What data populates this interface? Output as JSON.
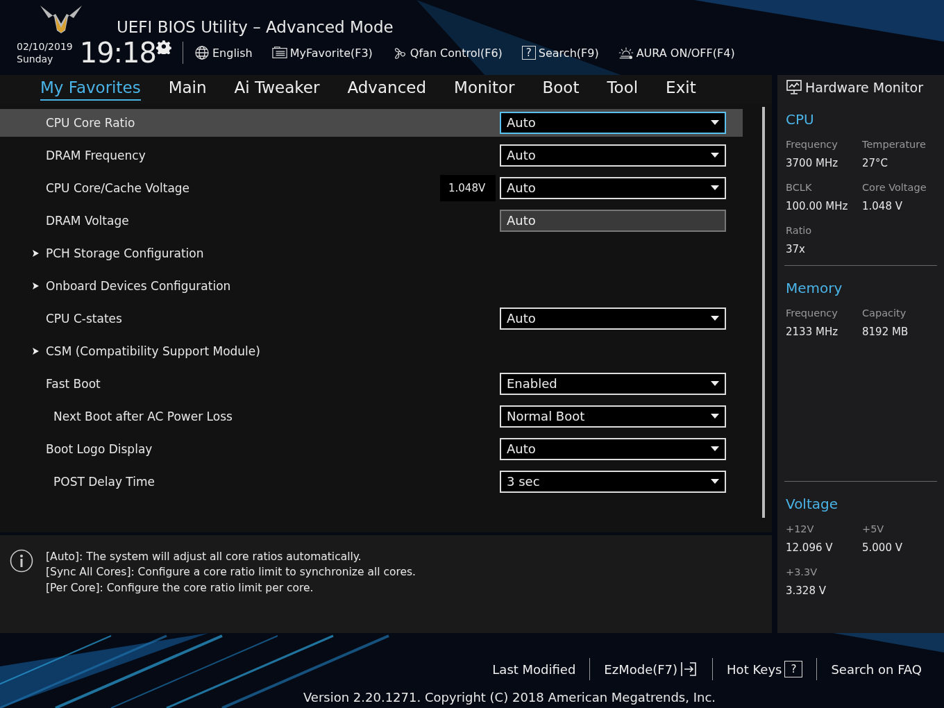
{
  "header": {
    "title": "UEFI BIOS Utility – Advanced Mode",
    "date": "02/10/2019",
    "day": "Sunday",
    "time": "19:18",
    "tools": [
      {
        "kind": "language",
        "label": "English"
      },
      {
        "kind": "favorite",
        "label": "MyFavorite(F3)"
      },
      {
        "kind": "fan",
        "label": "Qfan Control(F6)"
      },
      {
        "kind": "search",
        "label": "Search(F9)",
        "glyph": "?"
      },
      {
        "kind": "aura",
        "label": "AURA ON/OFF(F4)"
      }
    ]
  },
  "tabs": [
    {
      "label": "My Favorites",
      "selected": true
    },
    {
      "label": "Main",
      "selected": false
    },
    {
      "label": "Ai Tweaker",
      "selected": false
    },
    {
      "label": "Advanced",
      "selected": false
    },
    {
      "label": "Monitor",
      "selected": false
    },
    {
      "label": "Boot",
      "selected": false
    },
    {
      "label": "Tool",
      "selected": false
    },
    {
      "label": "Exit",
      "selected": false
    }
  ],
  "settings": [
    {
      "kind": "dropdown",
      "label": "CPU Core Ratio",
      "value": "Auto",
      "selected": true
    },
    {
      "kind": "dropdown",
      "label": "DRAM Frequency",
      "value": "Auto",
      "selected": false
    },
    {
      "kind": "dropdown",
      "label": "CPU Core/Cache Voltage",
      "reading": "1.048V",
      "value": "Auto",
      "selected": false
    },
    {
      "kind": "text",
      "label": "DRAM Voltage",
      "value": "Auto",
      "selected": false
    },
    {
      "kind": "submenu",
      "label": "PCH Storage Configuration",
      "selected": false
    },
    {
      "kind": "submenu",
      "label": "Onboard Devices Configuration",
      "selected": false
    },
    {
      "kind": "dropdown",
      "label": "CPU C-states",
      "value": "Auto",
      "selected": false
    },
    {
      "kind": "submenu",
      "label": "CSM (Compatibility Support Module)",
      "selected": false
    },
    {
      "kind": "dropdown",
      "label": "Fast Boot",
      "value": "Enabled",
      "selected": false,
      "children": [
        {
          "kind": "dropdown",
          "label": "Next Boot after AC Power Loss",
          "value": "Normal Boot",
          "selected": false
        }
      ]
    },
    {
      "kind": "dropdown",
      "label": "Boot Logo Display",
      "value": "Auto",
      "selected": false,
      "children": [
        {
          "kind": "dropdown",
          "label": "POST Delay Time",
          "value": "3 sec",
          "selected": false
        }
      ]
    }
  ],
  "help": [
    "[Auto]: The system will adjust all core ratios automatically.",
    "[Sync All Cores]: Configure a core ratio limit to synchronize all cores.",
    "[Per Core]: Configure the core ratio limit per core."
  ],
  "hardware_monitor": {
    "title": "Hardware Monitor",
    "sections": [
      {
        "title": "CPU",
        "items": [
          {
            "label": "Frequency",
            "value": "3700 MHz"
          },
          {
            "label": "Temperature",
            "value": "27°C"
          },
          {
            "label": "BCLK",
            "value": "100.00 MHz"
          },
          {
            "label": "Core Voltage",
            "value": "1.048 V"
          },
          {
            "label": "Ratio",
            "value": "37x"
          }
        ]
      },
      {
        "title": "Memory",
        "items": [
          {
            "label": "Frequency",
            "value": "2133 MHz"
          },
          {
            "label": "Capacity",
            "value": "8192 MB"
          }
        ]
      },
      {
        "title": "Voltage",
        "items": [
          {
            "label": "+12V",
            "value": "12.096 V"
          },
          {
            "label": "+5V",
            "value": "5.000 V"
          },
          {
            "label": "+3.3V",
            "value": "3.328 V"
          }
        ]
      }
    ]
  },
  "footer": {
    "links": [
      {
        "kind": "plain",
        "label": "Last Modified"
      },
      {
        "kind": "exit",
        "label": "EzMode(F7)"
      },
      {
        "kind": "help",
        "label": "Hot Keys",
        "glyph": "?"
      },
      {
        "kind": "plain",
        "label": "Search on FAQ"
      }
    ],
    "version": "Version 2.20.1271. Copyright (C) 2018 American Megatrends, Inc."
  }
}
